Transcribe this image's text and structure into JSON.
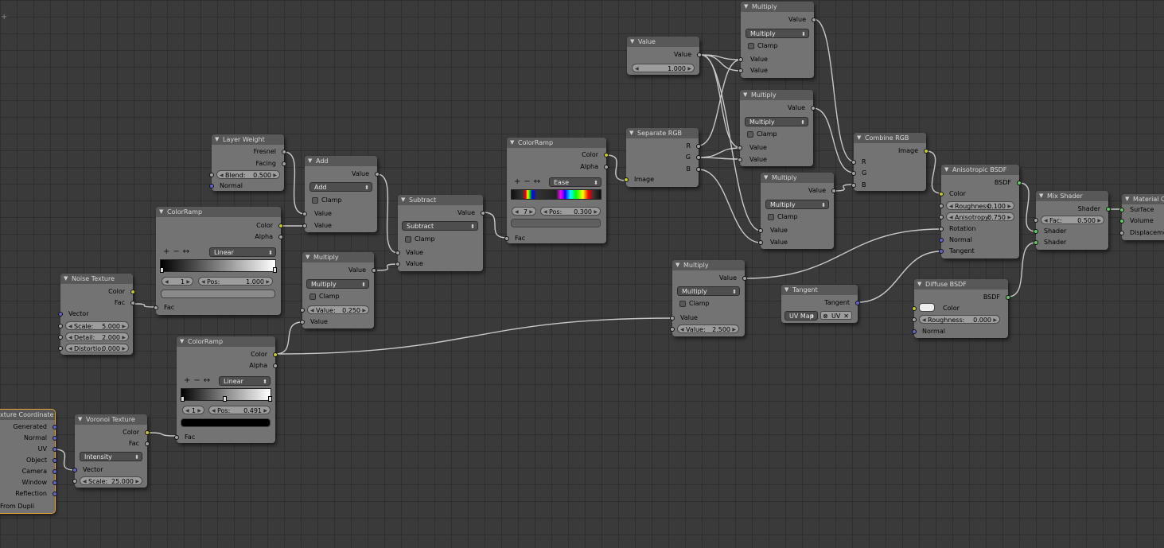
{
  "editor": {
    "corner_glyph": "+"
  },
  "nodes": {
    "value": {
      "title": "Value",
      "out": "Value",
      "field": "1.000"
    },
    "mul1": {
      "title": "Multiply",
      "out": "Value",
      "op": "Multiply",
      "clamp": "Clamp",
      "in1": "Value",
      "in2": "Value"
    },
    "mul2": {
      "title": "Multiply",
      "out": "Value",
      "op": "Multiply",
      "clamp": "Clamp",
      "in1": "Value",
      "in2": "Value"
    },
    "mul3": {
      "title": "Multiply",
      "out": "Value",
      "op": "Multiply",
      "clamp": "Clamp",
      "in1": "Value",
      "in2": "Value"
    },
    "seprgb": {
      "title": "Separate RGB",
      "r": "R",
      "g": "G",
      "b": "B",
      "in": "Image"
    },
    "combrgb": {
      "title": "Combine RGB",
      "out": "Image",
      "r": "R",
      "g": "G",
      "b": "B"
    },
    "colorramp_top": {
      "title": "ColorRamp",
      "color": "Color",
      "alpha": "Alpha",
      "interp": "Ease",
      "index": "7",
      "pos_label": "Pos:",
      "pos": "0.300",
      "fac": "Fac"
    },
    "layerweight": {
      "title": "Layer Weight",
      "fresnel": "Fresnel",
      "facing": "Facing",
      "blend_label": "Blend:",
      "blend": "0.500",
      "normal": "Normal"
    },
    "add": {
      "title": "Add",
      "out": "Value",
      "op": "Add",
      "clamp": "Clamp",
      "in1": "Value",
      "in2": "Value"
    },
    "subtract": {
      "title": "Subtract",
      "out": "Value",
      "op": "Subtract",
      "clamp": "Clamp",
      "in1": "Value",
      "in2": "Value"
    },
    "colorramp_mid": {
      "title": "ColorRamp",
      "color": "Color",
      "alpha": "Alpha",
      "interp": "Linear",
      "index": "1",
      "pos_label": "Pos:",
      "pos": "1.000",
      "fac": "Fac"
    },
    "mul4": {
      "title": "Multiply",
      "out": "Value",
      "op": "Multiply",
      "clamp": "Clamp",
      "val_label": "Value:",
      "val": "0.250",
      "in": "Value"
    },
    "noise": {
      "title": "Noise Texture",
      "color": "Color",
      "fac": "Fac",
      "vector": "Vector",
      "scale_label": "Scale:",
      "scale": "5.000",
      "detail_label": "Detail:",
      "detail": "2.000",
      "distortion_label": "Distortio:",
      "distortion": "0.000"
    },
    "colorramp_low": {
      "title": "ColorRamp",
      "color": "Color",
      "alpha": "Alpha",
      "interp": "Linear",
      "index": "1",
      "pos_label": "Pos:",
      "pos": "0.491",
      "fac": "Fac"
    },
    "mul5": {
      "title": "Multiply",
      "out": "Value",
      "op": "Multiply",
      "clamp": "Clamp",
      "in": "Value",
      "val_label": "Value:",
      "val": "2.500"
    },
    "tangent": {
      "title": "Tangent",
      "out": "Tangent",
      "mode": "UV Map",
      "uv": "UV"
    },
    "aniso": {
      "title": "Anisotropic BSDF",
      "out": "BSDF",
      "color": "Color",
      "rough_label": "Roughness:",
      "rough": "0.100",
      "aniso_label": "Anisotropy:",
      "aniso": "0.750",
      "rotation": "Rotation",
      "normal": "Normal",
      "tangent": "Tangent"
    },
    "diffuse": {
      "title": "Diffuse BSDF",
      "out": "BSDF",
      "color": "Color",
      "rough_label": "Roughness:",
      "rough": "0.000",
      "normal": "Normal"
    },
    "mixshader": {
      "title": "Mix Shader",
      "out": "Shader",
      "fac_label": "Fac:",
      "fac": "0.500",
      "in1": "Shader",
      "in2": "Shader"
    },
    "matout": {
      "title": "Material Ou",
      "surface": "Surface",
      "volume": "Volume",
      "displacement": "Displaceme"
    },
    "texcoord": {
      "title": "xture Coordinate",
      "generated": "Generated",
      "normal": "Normal",
      "uv": "UV",
      "object": "Object",
      "camera": "Camera",
      "window": "Window",
      "reflection": "Reflection",
      "from_dupli": "From Dupli"
    },
    "voronoi": {
      "title": "Voronoi Texture",
      "color": "Color",
      "fac": "Fac",
      "coloring": "Intensity",
      "vector": "Vector",
      "scale_label": "Scale:",
      "scale": "25.000"
    }
  },
  "colors": {
    "node_body": "#737373",
    "node_header": "#585858",
    "socket_color": "#c7c729",
    "socket_value": "#a1a1a1",
    "socket_vector": "#6363c7",
    "socket_shader": "#63c763",
    "active_outline": "#e8a33a",
    "link": "#c8c8c8"
  }
}
